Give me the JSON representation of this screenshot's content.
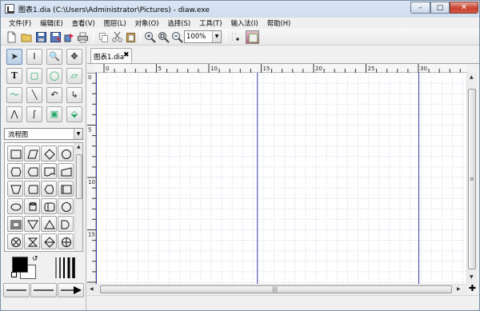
{
  "window": {
    "title": "图表1.dia (C:\\Users\\Administrator\\Pictures) - diaw.exe",
    "minimize_glyph": "–",
    "maximize_glyph": "□",
    "close_glyph": "✕"
  },
  "menu": [
    "文件(F)",
    "编辑(E)",
    "查看(V)",
    "图层(L)",
    "对象(O)",
    "选择(S)",
    "工具(T)",
    "输入法(I)",
    "帮助(H)"
  ],
  "toolbar": {
    "zoom": "100%",
    "icons": [
      "new-icon",
      "open-icon",
      "save-icon",
      "save-as-icon",
      "export-icon",
      "print-icon",
      "copy-icon",
      "cut-icon",
      "paste-icon",
      "zoom-in-icon",
      "zoom-fit-icon",
      "zoom-out-icon",
      "grid-icon",
      "snap-icon"
    ]
  },
  "tools": [
    {
      "name": "pointer",
      "glyph": "➤",
      "selected": true
    },
    {
      "name": "text-cursor",
      "glyph": "I"
    },
    {
      "name": "zoom",
      "glyph": "🔍"
    },
    {
      "name": "move",
      "glyph": "✥"
    },
    {
      "name": "text",
      "glyph": "T"
    },
    {
      "name": "box",
      "glyph": "▢"
    },
    {
      "name": "ellipse",
      "glyph": "◯"
    },
    {
      "name": "polygon",
      "glyph": "▱"
    },
    {
      "name": "bezier",
      "glyph": "〜"
    },
    {
      "name": "line",
      "glyph": "╲"
    },
    {
      "name": "arc",
      "glyph": "↶"
    },
    {
      "name": "zigzag",
      "glyph": "↳"
    },
    {
      "name": "polyline",
      "glyph": "⋀"
    },
    {
      "name": "bezierline",
      "glyph": "ʃ"
    },
    {
      "name": "image",
      "glyph": "▣"
    },
    {
      "name": "outline",
      "glyph": "⬙"
    }
  ],
  "sheet": "流程图",
  "shapes": [
    "process",
    "data",
    "decision",
    "terminal",
    "preparation",
    "alternate",
    "document",
    "manual-input",
    "manual-operation",
    "storage",
    "display",
    "connector",
    "predefined",
    "merge",
    "extract",
    "delay",
    "summing",
    "collate",
    "sort",
    "or"
  ],
  "tab": {
    "label": "图表1.dia",
    "close": "✖"
  },
  "ruler": {
    "h_ticks": [
      "0",
      "5",
      "10",
      "15",
      "20",
      "25",
      "30"
    ],
    "v_ticks": [
      "0",
      "5",
      "10",
      "15"
    ]
  },
  "colors": {
    "foreground": "#000000",
    "background": "#ffffff",
    "page_break": "#3a3ab4",
    "grid": "#c8d2e6"
  }
}
